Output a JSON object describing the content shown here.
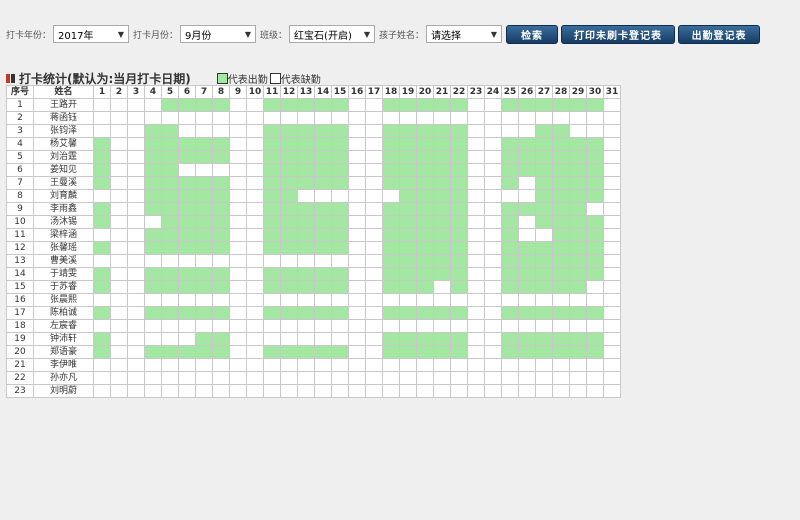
{
  "filters": {
    "year_label": "打卡年份：",
    "year_value": "2017年",
    "month_label": "打卡月份：",
    "month_value": "9月份",
    "class_label": "班级：",
    "class_value": "红宝石(开启)",
    "child_label": "孩子姓名：",
    "child_value": "请选择"
  },
  "buttons": {
    "search": "检索",
    "print_unpunched": "打印未刷卡登记表",
    "attendance_register": "出勤登记表"
  },
  "section": {
    "title": "打卡统计(默认为:当月打卡日期)",
    "legend_present": "代表出勤",
    "legend_absent": "代表缺勤"
  },
  "colors": {
    "present": "#a3e7a2",
    "button": "#1f4a78"
  },
  "table": {
    "col_index": "序号",
    "col_name": "姓名",
    "days": [
      "1",
      "2",
      "3",
      "4",
      "5",
      "6",
      "7",
      "8",
      "9",
      "10",
      "11",
      "12",
      "13",
      "14",
      "15",
      "16",
      "17",
      "18",
      "19",
      "20",
      "21",
      "22",
      "23",
      "24",
      "25",
      "26",
      "27",
      "28",
      "29",
      "30",
      "31"
    ],
    "rows": [
      {
        "no": "1",
        "name": "王路开",
        "present": [
          5,
          6,
          7,
          8,
          11,
          12,
          13,
          14,
          15,
          18,
          19,
          20,
          21,
          22,
          25,
          26,
          27,
          28,
          29,
          30
        ]
      },
      {
        "no": "2",
        "name": "蒋函钰",
        "present": []
      },
      {
        "no": "3",
        "name": "张钧泽",
        "present": [
          4,
          5,
          11,
          12,
          13,
          14,
          15,
          18,
          19,
          20,
          21,
          22,
          27,
          28
        ]
      },
      {
        "no": "4",
        "name": "杨艾馨",
        "present": [
          1,
          4,
          5,
          6,
          7,
          8,
          11,
          12,
          13,
          14,
          15,
          18,
          19,
          20,
          21,
          22,
          25,
          26,
          27,
          28,
          29,
          30
        ]
      },
      {
        "no": "5",
        "name": "刘治霆",
        "present": [
          1,
          4,
          5,
          6,
          7,
          8,
          11,
          12,
          13,
          14,
          15,
          18,
          19,
          20,
          21,
          22,
          25,
          26,
          27,
          28,
          29,
          30
        ]
      },
      {
        "no": "6",
        "name": "姜知见",
        "present": [
          1,
          4,
          5,
          11,
          12,
          13,
          14,
          15,
          18,
          19,
          20,
          21,
          22,
          25,
          26,
          27,
          28,
          29,
          30
        ]
      },
      {
        "no": "7",
        "name": "王曼溪",
        "present": [
          1,
          4,
          5,
          6,
          7,
          8,
          11,
          12,
          13,
          14,
          15,
          18,
          19,
          20,
          21,
          22,
          25,
          27,
          28,
          29,
          30
        ]
      },
      {
        "no": "8",
        "name": "刘育麟",
        "present": [
          4,
          5,
          6,
          7,
          8,
          11,
          12,
          19,
          20,
          21,
          22,
          27,
          28,
          29,
          30
        ]
      },
      {
        "no": "9",
        "name": "李雨鑫",
        "present": [
          1,
          4,
          5,
          6,
          7,
          8,
          11,
          12,
          13,
          14,
          15,
          18,
          19,
          20,
          21,
          22,
          25,
          26,
          27,
          28,
          29
        ]
      },
      {
        "no": "10",
        "name": "汤沐锡",
        "present": [
          1,
          5,
          6,
          7,
          8,
          11,
          12,
          13,
          14,
          15,
          18,
          19,
          20,
          21,
          22,
          25,
          27,
          28,
          29,
          30
        ]
      },
      {
        "no": "11",
        "name": "梁梓涵",
        "present": [
          4,
          5,
          6,
          7,
          8,
          11,
          12,
          13,
          14,
          15,
          18,
          19,
          20,
          21,
          22,
          25,
          28,
          29,
          30
        ]
      },
      {
        "no": "12",
        "name": "张馨瑶",
        "present": [
          1,
          4,
          5,
          6,
          7,
          8,
          11,
          12,
          13,
          14,
          15,
          18,
          19,
          20,
          21,
          22,
          25,
          26,
          27,
          28,
          29,
          30
        ]
      },
      {
        "no": "13",
        "name": "曹美溪",
        "present": [
          18,
          19,
          20,
          21,
          22,
          25,
          26,
          27,
          28,
          29,
          30
        ]
      },
      {
        "no": "14",
        "name": "于靖雯",
        "present": [
          1,
          4,
          5,
          6,
          7,
          8,
          11,
          12,
          13,
          14,
          15,
          18,
          19,
          20,
          21,
          22,
          25,
          26,
          27,
          28,
          29,
          30
        ]
      },
      {
        "no": "15",
        "name": "于苏睿",
        "present": [
          1,
          4,
          5,
          6,
          7,
          8,
          11,
          12,
          13,
          14,
          15,
          18,
          19,
          20,
          22,
          25,
          26,
          27,
          28,
          29
        ]
      },
      {
        "no": "16",
        "name": "张晨熙",
        "present": []
      },
      {
        "no": "17",
        "name": "陈柏诚",
        "present": [
          1,
          4,
          5,
          6,
          7,
          8,
          11,
          12,
          13,
          14,
          15,
          18,
          19,
          20,
          21,
          22,
          25,
          26,
          27,
          28,
          29,
          30
        ]
      },
      {
        "no": "18",
        "name": "左宸睿",
        "present": []
      },
      {
        "no": "19",
        "name": "钟沛轩",
        "present": [
          1,
          7,
          8,
          18,
          19,
          20,
          21,
          22,
          25,
          26,
          27,
          28,
          29,
          30
        ]
      },
      {
        "no": "20",
        "name": "郑语豪",
        "present": [
          1,
          4,
          5,
          6,
          7,
          8,
          11,
          12,
          13,
          14,
          15,
          18,
          19,
          20,
          21,
          22,
          25,
          26,
          27,
          28,
          29,
          30
        ]
      },
      {
        "no": "21",
        "name": "李伊唯",
        "present": []
      },
      {
        "no": "22",
        "name": "孙亦凡",
        "present": []
      },
      {
        "no": "23",
        "name": "刘明蔚",
        "present": []
      }
    ]
  }
}
